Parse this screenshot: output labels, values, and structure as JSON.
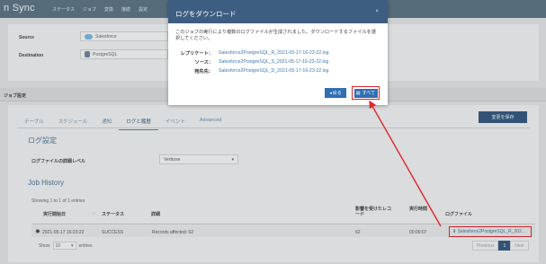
{
  "app": {
    "logo": "n Sync",
    "nav": [
      "ステータス",
      "ジョブ",
      "変換",
      "接続",
      "設定"
    ]
  },
  "connection": {
    "source_label": "Source",
    "source_value": "Salesforce",
    "destination_label": "Destination",
    "destination_value": "PostgreSQL"
  },
  "section": {
    "title": "ジョブ設定"
  },
  "tabs": [
    "テーブル",
    "スケジュール",
    "通知",
    "ログと履歴",
    "イベント",
    "Advanced"
  ],
  "active_tab_index": 3,
  "save_button": "変更を保存",
  "log_settings": {
    "heading": "ログ設定",
    "level_label": "ログファイルの詳細レベル",
    "level_value": "Verbose"
  },
  "job_history": {
    "heading": "Job History",
    "showing": "Showing 1 to 1 of 1 entries",
    "columns": {
      "run_date": "実行開始日",
      "status": "ステータス",
      "detail": "詳細",
      "records": "影響を受けたレコード",
      "duration": "実行時間",
      "logfile": "ログファイル"
    },
    "row": {
      "run_date": "2021-05-17 16:23:22",
      "status": "SUCCESS",
      "detail": "Records affected: 62",
      "records": "62",
      "duration": "00:00:07",
      "logfile": "Salesforce2PostgreSQL_R_202..."
    },
    "show_label": "Show",
    "show_value": "10",
    "entries_label": "entries",
    "pager": {
      "prev": "Previous",
      "page": "1",
      "next": "Next"
    }
  },
  "modal": {
    "title": "ログをダウンロード",
    "close": "×",
    "message": "このジョブの実行により複数のログファイルが生成されました。ダウンロードするファイルを選択してください。",
    "files": [
      {
        "label": "レプリケート：",
        "link": "Salesforce2PostgreSQL_R_2021-05-17-16-23-22.log"
      },
      {
        "label": "ソース：",
        "link": "Salesforce2PostgreSQL_S_2021-05-17-16-23-22.log"
      },
      {
        "label": "宛先先：",
        "link": "Salesforce2PostgreSQL_D_2021-05-17-16-23-22.log"
      }
    ],
    "back_button": "戻る",
    "all_button": "すべて"
  },
  "colors": {
    "accent": "#3d5e80",
    "primary_button": "#2f6fb2",
    "highlight": "#d4252b"
  }
}
